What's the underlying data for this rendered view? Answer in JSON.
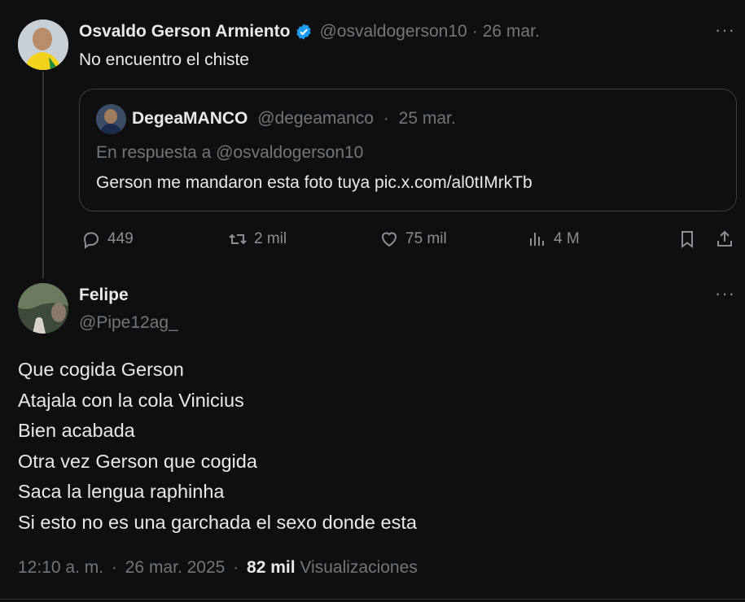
{
  "main_tweet": {
    "author_name": "Osvaldo Gerson Armiento",
    "handle": "@osvaldogerson10",
    "separator": "·",
    "date": "26 mar.",
    "text": "No encuentro el chiste",
    "more": "···"
  },
  "quoted_tweet": {
    "author_name": "DegeaMANCO",
    "handle": "@degeamanco",
    "separator": "·",
    "date": "25 mar.",
    "reply_to": "En respuesta a @osvaldogerson10",
    "text": "Gerson me mandaron esta foto tuya pic.x.com/al0tIMrkTb"
  },
  "actions": {
    "replies": "449",
    "retweets": "2 mil",
    "likes": "75 mil",
    "views": "4 M"
  },
  "reply_tweet": {
    "author_name": "Felipe",
    "handle": "@Pipe12ag_",
    "more": "···",
    "lines": [
      "Que cogida Gerson",
      "Atajala con la cola Vinicius",
      "Bien acabada",
      "Otra vez Gerson que cogida",
      "Saca la lengua raphinha",
      "Si esto no es una garchada el sexo donde esta"
    ],
    "time": "12:10 a. m.",
    "separator1": "·",
    "full_date": "26 mar. 2025",
    "separator2": "·",
    "views_count": "82 mil",
    "views_label": "Visualizaciones"
  },
  "colors": {
    "background": "#0f0f10",
    "text": "#e7e9ea",
    "muted": "#71767b",
    "verified": "#1d9bf0"
  }
}
